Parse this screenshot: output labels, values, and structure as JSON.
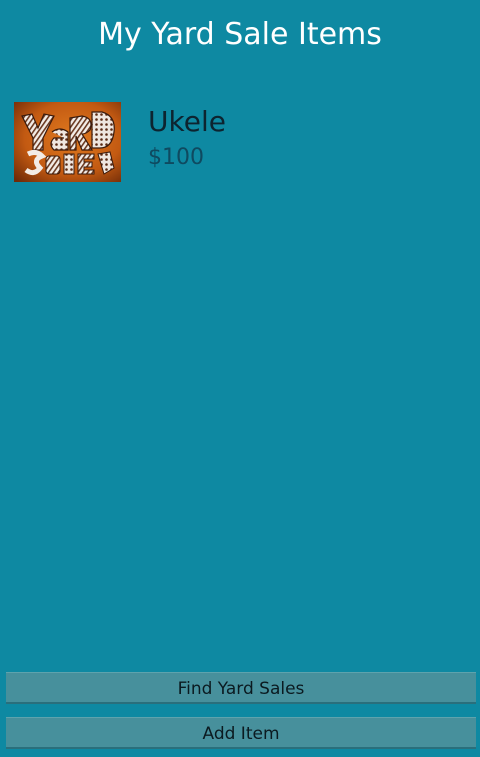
{
  "header": {
    "title": "My Yard Sale Items"
  },
  "items": [
    {
      "name": "Ukele",
      "price": "$100",
      "thumbnail_icon": "yard-sale-sign-image"
    }
  ],
  "buttons": {
    "find_label": "Find Yard Sales",
    "add_label": "Add Item"
  },
  "colors": {
    "background": "#0e89a2",
    "button": "#47909c",
    "title": "#ffffff"
  }
}
